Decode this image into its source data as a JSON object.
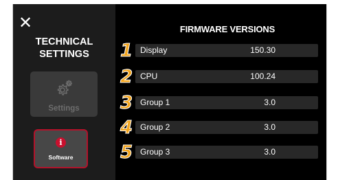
{
  "sidebar": {
    "close_icon": "close-icon",
    "title_line1": "TECHNICAL",
    "title_line2": "SETTINGS",
    "items": [
      {
        "label": "Settings",
        "icon": "gear-icon",
        "state": "disabled"
      },
      {
        "label": "Software",
        "icon": "info-icon",
        "state": "selected",
        "accent": "#c8102e"
      }
    ]
  },
  "panel": {
    "title": "FIRMWARE VERSIONS",
    "rows": [
      {
        "index": "1",
        "name": "Display",
        "version": "150.30"
      },
      {
        "index": "2",
        "name": "CPU",
        "version": "100.24"
      },
      {
        "index": "3",
        "name": "Group 1",
        "version": "3.0"
      },
      {
        "index": "4",
        "name": "Group 2",
        "version": "3.0"
      },
      {
        "index": "5",
        "name": "Group 3",
        "version": "3.0"
      }
    ]
  },
  "colors": {
    "background": "#000000",
    "sidebar": "#1c1c1c",
    "row_bar": "#282828",
    "callout_number": "#f4a51c",
    "selected_border": "#b3122a"
  }
}
